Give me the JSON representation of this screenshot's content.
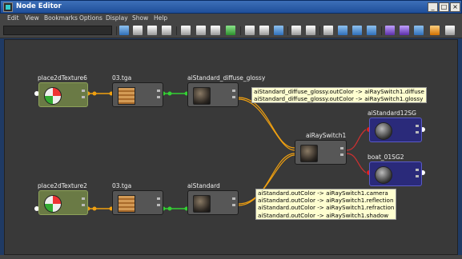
{
  "window": {
    "title": "Node Editor",
    "min": "_",
    "max": "□",
    "close": "×"
  },
  "menu": [
    "Edit",
    "View",
    "Bookmarks",
    "Options",
    "Display",
    "Show",
    "Help"
  ],
  "nodes": {
    "place2dTexture6": "place2dTexture6",
    "tga1": "03.tga",
    "diffuse_glossy": "aiStandard_diffuse_glossy",
    "rayswitch": "aiRaySwitch1",
    "sg1": "aiStandard12SG",
    "sg2": "boat_01SG2",
    "place2dTexture2": "place2dTexture2",
    "tga2": "03.tga",
    "aistandard": "aiStandard"
  },
  "tooltips": {
    "top": [
      "aiStandard_diffuse_glossy.outColor -> aiRaySwitch1.diffuse",
      "aiStandard_diffuse_glossy.outColor -> aiRaySwitch1.glossy"
    ],
    "bottom": [
      "aiStandard.outColor -> aiRaySwitch1.camera",
      "aiStandard.outColor -> aiRaySwitch1.reflection",
      "aiStandard.outColor -> aiRaySwitch1.refraction",
      "aiStandard.outColor -> aiRaySwitch1.shadow"
    ]
  }
}
